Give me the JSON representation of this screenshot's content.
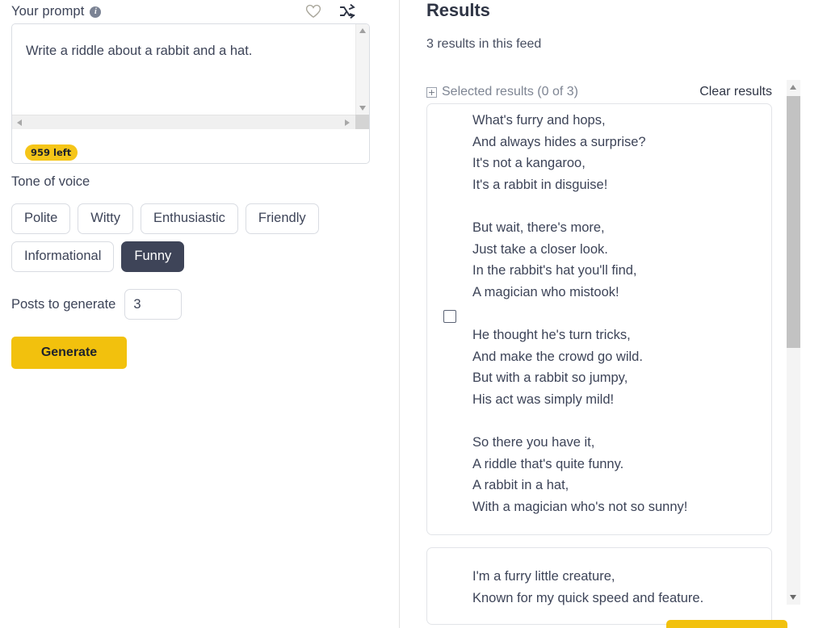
{
  "left": {
    "prompt_label": "Your prompt",
    "info_icon": "info-icon",
    "favorite_icon": "heart-icon",
    "shuffle_icon": "shuffle-icon",
    "prompt_value": "Write a riddle about a rabbit and a hat.",
    "prompt_placeholder": "Write a riddle about a rabbit and a hat.",
    "char_counter": "959 left",
    "tone_label": "Tone of voice",
    "tones": [
      {
        "label": "Polite",
        "selected": false
      },
      {
        "label": "Witty",
        "selected": false
      },
      {
        "label": "Enthusiastic",
        "selected": false
      },
      {
        "label": "Friendly",
        "selected": false
      },
      {
        "label": "Informational",
        "selected": false
      },
      {
        "label": "Funny",
        "selected": true
      }
    ],
    "posts_label": "Posts to generate",
    "posts_value": "3",
    "generate_label": "Generate"
  },
  "right": {
    "title": "Results",
    "subtitle": "3 results in this feed",
    "expand_icon": "plus-box-icon",
    "selected_results_label": "Selected results (0 of 3)",
    "clear_results_label": "Clear results",
    "results": [
      {
        "text": "What's furry and hops,\nAnd always hides a surprise?\nIt's not a kangaroo,\nIt's a rabbit in disguise!\n\nBut wait, there's more,\nJust take a closer look.\nIn the rabbit's hat you'll find,\nA magician who mistook!\n\nHe thought he's turn tricks,\nAnd make the crowd go wild.\nBut with a rabbit so jumpy,\nHis act was simply mild!\n\nSo there you have it,\nA riddle that's quite funny.\nA rabbit in a hat,\nWith a magician who's not so sunny!",
        "checked": false
      },
      {
        "text": "I'm a furry little creature,\nKnown for my quick speed and feature.",
        "checked": false
      }
    ]
  },
  "colors": {
    "accent_yellow": "#f2c10d",
    "badge_yellow": "#f5c518",
    "selected_dark": "#3e4458",
    "text": "#3d4458",
    "muted": "#7e8593",
    "border": "#e2e4e8"
  }
}
